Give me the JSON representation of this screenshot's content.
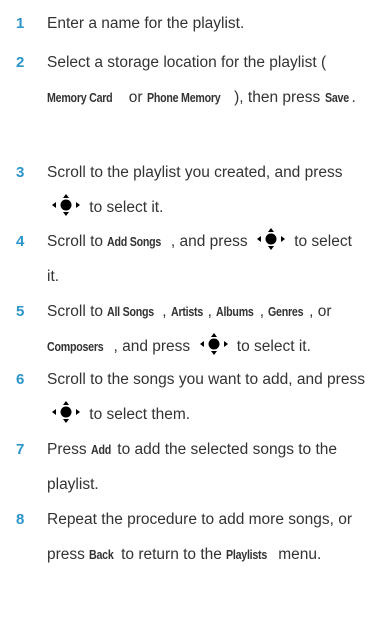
{
  "steps": [
    {
      "number": "1",
      "parts": [
        {
          "text": "Enter a name for the playlist."
        }
      ]
    },
    {
      "number": "2",
      "parts": [
        {
          "text": "Select a storage location for the playlist ("
        },
        {
          "key": "Memory Card"
        },
        {
          "text": " or "
        },
        {
          "key": "Phone Memory"
        },
        {
          "text": "), then press "
        },
        {
          "key": "Save"
        },
        {
          "text": "."
        }
      ]
    },
    {
      "number": "3",
      "parts": [
        {
          "text": "Scroll to the playlist you created, and press "
        },
        {
          "icon": "nav-key-center-icon"
        },
        {
          "text": " to select it."
        }
      ]
    },
    {
      "number": "4",
      "parts": [
        {
          "text": "Scroll to "
        },
        {
          "key": "Add Songs"
        },
        {
          "text": ", and press "
        },
        {
          "icon": "nav-key-center-icon"
        },
        {
          "text": " to select it."
        }
      ]
    },
    {
      "number": "5",
      "parts": [
        {
          "text": "Scroll to "
        },
        {
          "key": "All Songs"
        },
        {
          "text": ", "
        },
        {
          "key": "Artists"
        },
        {
          "text": ", "
        },
        {
          "key": "Albums"
        },
        {
          "text": ", "
        },
        {
          "key": "Genres"
        },
        {
          "text": ", or "
        },
        {
          "key": "Composers"
        },
        {
          "text": ", and press "
        },
        {
          "icon": "nav-key-center-icon"
        },
        {
          "text": " to select it."
        }
      ]
    },
    {
      "number": "6",
      "parts": [
        {
          "text": "Scroll to the songs you want to add, and press "
        },
        {
          "icon": "nav-key-center-icon"
        },
        {
          "text": " to select them."
        }
      ]
    },
    {
      "number": "7",
      "parts": [
        {
          "text": "Press "
        },
        {
          "key": "Add"
        },
        {
          "text": " to add the selected songs to the playlist."
        }
      ]
    },
    {
      "number": "8",
      "parts": [
        {
          "text": "Repeat the procedure to add more songs, or press "
        },
        {
          "key": "Back"
        },
        {
          "text": " to return to the "
        },
        {
          "key": "Playlists"
        },
        {
          "text": " menu."
        }
      ]
    }
  ],
  "colors": {
    "step_number": "#2b95c9",
    "body_text": "#333333",
    "icon": "#000000"
  }
}
